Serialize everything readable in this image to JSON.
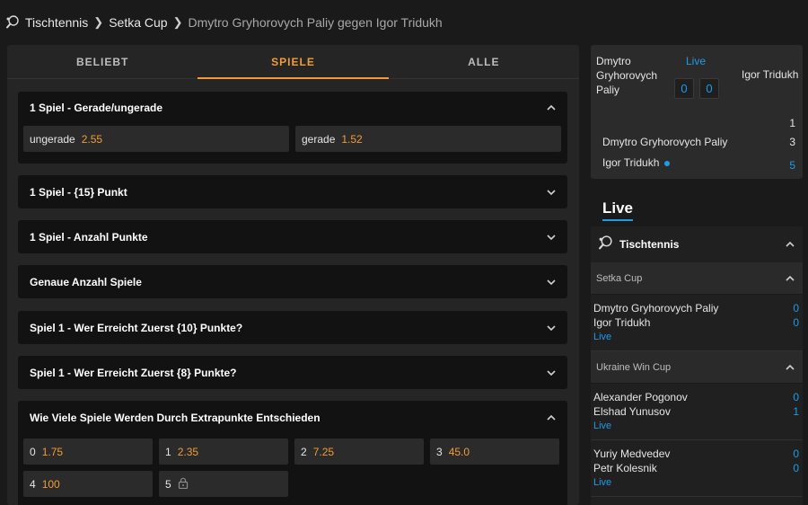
{
  "breadcrumb": {
    "items": [
      "Tischtennis",
      "Setka Cup"
    ],
    "current": "Dmytro Gryhorovych Paliy gegen Igor Tridukh"
  },
  "tabs": [
    {
      "label": "BELIEBT",
      "active": false
    },
    {
      "label": "SPIELE",
      "active": true
    },
    {
      "label": "ALLE",
      "active": false
    }
  ],
  "markets": [
    {
      "title": "1 Spiel - Gerade/ungerade",
      "expanded": true,
      "odds": [
        {
          "label": "ungerade",
          "value": "2.55"
        },
        {
          "label": "gerade",
          "value": "1.52"
        }
      ]
    },
    {
      "title": "1 Spiel - {15} Punkt",
      "expanded": false
    },
    {
      "title": "1 Spiel - Anzahl Punkte",
      "expanded": false
    },
    {
      "title": "Genaue Anzahl Spiele",
      "expanded": false
    },
    {
      "title": "Spiel 1 - Wer Erreicht Zuerst {10} Punkte?",
      "expanded": false
    },
    {
      "title": "Spiel 1 - Wer Erreicht Zuerst {8} Punkte?",
      "expanded": false
    },
    {
      "title": "Wie Viele Spiele Werden Durch Extrapunkte Entschieden",
      "expanded": true,
      "odds": [
        {
          "label": "0",
          "value": "1.75"
        },
        {
          "label": "1",
          "value": "2.35"
        },
        {
          "label": "2",
          "value": "7.25"
        },
        {
          "label": "3",
          "value": "45.0"
        },
        {
          "label": "4",
          "value": "100"
        },
        {
          "label": "5",
          "value": "",
          "locked": true
        }
      ]
    }
  ],
  "scoreboard": {
    "player1": "Dmytro Gryhorovych Paliy",
    "player2": "Igor Tridukh",
    "status": "Live",
    "sets_p1": "0",
    "sets_p2": "0",
    "game_header": "1",
    "row1_name": "Dmytro Gryhorovych Paliy",
    "row1_score": "3",
    "row2_name": "Igor Tridukh",
    "row2_score": "5"
  },
  "live_heading": "Live",
  "sidebar": {
    "sport": "Tischtennis",
    "leagues": [
      {
        "name": "Setka Cup",
        "matches": [
          {
            "p1": "Dmytro Gryhorovych Paliy",
            "s1": "0",
            "p2": "Igor Tridukh",
            "s2": "0",
            "status": "Live"
          }
        ]
      },
      {
        "name": "Ukraine Win Cup",
        "matches": [
          {
            "p1": "Alexander Pogonov",
            "s1": "0",
            "p2": "Elshad Yunusov",
            "s2": "1",
            "status": "Live"
          },
          {
            "p1": "Yuriy Medvedev",
            "s1": "0",
            "p2": "Petr Kolesnik",
            "s2": "0",
            "status": "Live"
          }
        ]
      }
    ]
  },
  "colors": {
    "accent": "#f29b38",
    "live": "#1e9bea",
    "background": "#1a1a1a"
  }
}
